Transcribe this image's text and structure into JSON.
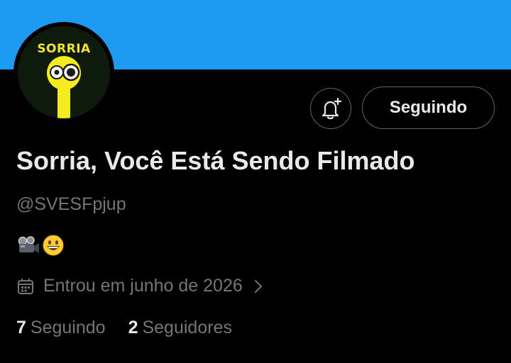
{
  "colors": {
    "banner": "#1d9bf0",
    "background": "#000000",
    "text_primary": "#e7e9ea",
    "text_secondary": "#71767b",
    "button_border": "#536471"
  },
  "profile": {
    "avatar_text": "SORRIA",
    "display_name": "Sorria, Você Está Sendo Filmado",
    "handle": "@SVESFpjup",
    "bio_icons": [
      "movie-camera-icon",
      "grinning-face-icon"
    ],
    "joined_icon": "calendar-icon",
    "joined": "Entrou em junho de 2026"
  },
  "actions": {
    "notifications_icon": "bell-plus-icon",
    "follow_label": "Seguindo"
  },
  "stats": {
    "following_count": "7",
    "following_label": "Seguindo",
    "followers_count": "2",
    "followers_label": "Seguidores"
  }
}
